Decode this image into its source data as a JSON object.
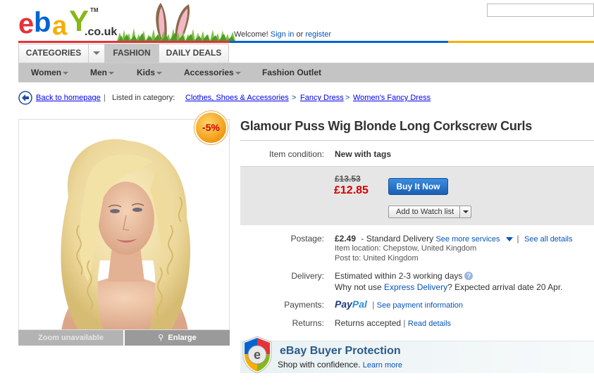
{
  "header": {
    "logo": {
      "e": "e",
      "b": "b",
      "a": "a",
      "y": "Y",
      "tm": "TM",
      "domain": ".co.uk"
    },
    "welcome_text": "Welcome!",
    "sign_in": "Sign in",
    "or": "or",
    "register": "register",
    "search_value": ""
  },
  "tabs": {
    "categories": "CATEGORIES",
    "fashion": "FASHION",
    "daily_deals": "DAILY DEALS"
  },
  "subnav": [
    "Women",
    "Men",
    "Kids",
    "Accessories",
    "Fashion Outlet"
  ],
  "breadcrumb": {
    "back": "Back to homepage",
    "listed": "Listed in category:",
    "cat1": "Clothes, Shoes & Accessories",
    "cat2": "Fancy Dress",
    "cat3": "Women's Fancy Dress"
  },
  "image_panel": {
    "discount": "-5%",
    "zoom": "Zoom unavailable",
    "enlarge": "Enlarge"
  },
  "item": {
    "title": "Glamour Puss Wig Blonde Long Corkscrew Curls",
    "condition_label": "Item condition:",
    "condition": "New with tags",
    "old_price": "£13.53",
    "price": "£12.85",
    "buy_now": "Buy It Now",
    "watch": "Add to Watch list",
    "postage_label": "Postage:",
    "postage_price": "£2.49",
    "postage_service": "- Standard Delivery",
    "see_more": "See more services",
    "see_all": "See all details",
    "location": "Item location: Chepstow, United Kingdom",
    "post_to": "Post to: United Kingdom",
    "delivery_label": "Delivery:",
    "delivery_est": "Estimated within 2-3 working days",
    "why_not": "Why not use",
    "express": "Express Delivery",
    "expected": "? Expected arrival date 20 Apr.",
    "payments_label": "Payments:",
    "paypal1": "Pay",
    "paypal2": "Pal",
    "see_payment": "See payment information",
    "returns_label": "Returns:",
    "returns": "Returns accepted",
    "read_details": "Read details"
  },
  "protection": {
    "title": "eBay Buyer Protection",
    "sub": "Shop with confidence.",
    "learn": "Learn more"
  },
  "colors": {
    "ebay_red": "#e53238",
    "ebay_blue": "#0064d2",
    "ebay_yellow": "#f5af02",
    "ebay_green": "#86b817",
    "link": "#0654ba",
    "price": "#d40000"
  }
}
